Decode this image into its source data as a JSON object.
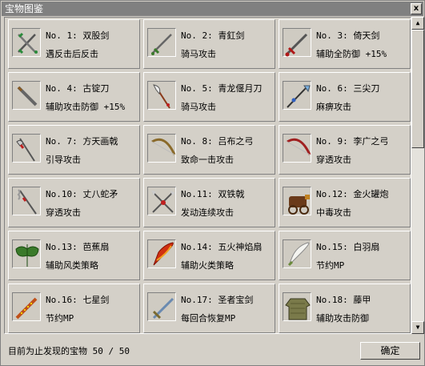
{
  "window": {
    "title": "宝物图鉴",
    "close_label": "x"
  },
  "items": [
    {
      "title": "No. 1: 双股剑",
      "effect": "遇反击后反击",
      "icon": "twin-swords-icon"
    },
    {
      "title": "No. 2: 青釭剑",
      "effect": "骑马攻击",
      "icon": "sword-icon"
    },
    {
      "title": "No. 3: 倚天剑",
      "effect": "辅助全防御 +15%",
      "icon": "red-sword-icon"
    },
    {
      "title": "No. 4: 古锭刀",
      "effect": "辅助攻击防御 +15%",
      "icon": "broadsword-icon"
    },
    {
      "title": "No. 5: 青龙偃月刀",
      "effect": "骑马攻击",
      "icon": "glaive-icon"
    },
    {
      "title": "No. 6: 三尖刀",
      "effect": "麻痹攻击",
      "icon": "trident-blade-icon"
    },
    {
      "title": "No. 7: 方天画戟",
      "effect": "引导攻击",
      "icon": "halberd-icon"
    },
    {
      "title": "No. 8: 吕布之弓",
      "effect": "致命一击攻击",
      "icon": "bow-icon"
    },
    {
      "title": "No. 9: 李广之弓",
      "effect": "穿透攻击",
      "icon": "red-bow-icon"
    },
    {
      "title": "No.10: 丈八蛇矛",
      "effect": "穿透攻击",
      "icon": "serpent-spear-icon"
    },
    {
      "title": "No.11: 双铁戟",
      "effect": "发动连续攻击",
      "icon": "twin-halberds-icon"
    },
    {
      "title": "No.12: 金火罐炮",
      "effect": "中毒攻击",
      "icon": "cannon-icon"
    },
    {
      "title": "No.13: 芭蕉扇",
      "effect": "辅助风类策略",
      "icon": "leaf-fan-icon"
    },
    {
      "title": "No.14: 五火神焰扇",
      "effect": "辅助火类策略",
      "icon": "fire-fan-icon"
    },
    {
      "title": "No.15: 白羽扇",
      "effect": "节约MP",
      "icon": "feather-fan-icon"
    },
    {
      "title": "No.16: 七星剑",
      "effect": "节约MP",
      "icon": "seven-star-sword-icon"
    },
    {
      "title": "No.17: 圣者宝剑",
      "effect": "每回合恢复MP",
      "icon": "holy-sword-icon"
    },
    {
      "title": "No.18: 藤甲",
      "effect": "辅助攻击防御",
      "icon": "rattan-armor-icon"
    }
  ],
  "scrollbar": {
    "up_label": "▲",
    "down_label": "▼"
  },
  "status": {
    "text": "目前为止发现的宝物 50 / 50"
  },
  "ok_button": {
    "label": "确定"
  }
}
